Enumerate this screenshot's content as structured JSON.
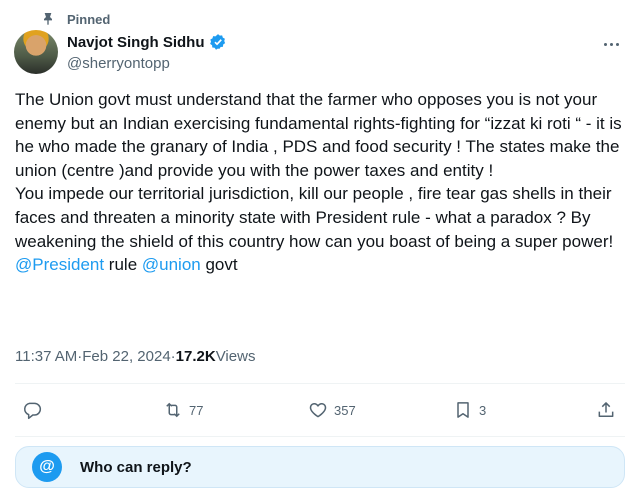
{
  "pinned": {
    "label": "Pinned",
    "icon": "pin-icon"
  },
  "author": {
    "name": "Navjot Singh Sidhu",
    "handle": "@sherryontopp",
    "verified_icon": "verified-badge-icon"
  },
  "tweet": {
    "text_main": "The Union govt must understand that the farmer who opposes you is not your enemy but an Indian exercising fundamental rights-fighting for “izzat ki roti “ - it is he who made the granary of India , PDS and food security ! The states make the union (centre )and provide you with the power taxes and entity !\nYou impede our territorial jurisdiction, kill our people , fire tear gas shells in their faces and threaten a minority state with President rule - what a paradox ? By weakening the shield of this country how can you boast of being a super power!\n",
    "mention1": "@President",
    "mid1": " rule ",
    "mention2": "@union",
    "tail": " govt"
  },
  "meta": {
    "time": "11:37 AM",
    "sep": " · ",
    "date": "Feb 22, 2024",
    "sep2": " · ",
    "views_count": "17.2K",
    "views_label": " Views"
  },
  "actions": {
    "reply": {
      "icon": "reply-icon",
      "count": ""
    },
    "retweet": {
      "icon": "retweet-icon",
      "count": "77"
    },
    "like": {
      "icon": "heart-icon",
      "count": "357"
    },
    "bookmark": {
      "icon": "bookmark-icon",
      "count": "3"
    },
    "share": {
      "icon": "share-icon",
      "count": ""
    }
  },
  "reply_settings": {
    "title": "Who can reply?",
    "icon_text": "@"
  },
  "colors": {
    "accent": "#1d9bf0",
    "muted": "#536471",
    "text": "#0f1419"
  }
}
